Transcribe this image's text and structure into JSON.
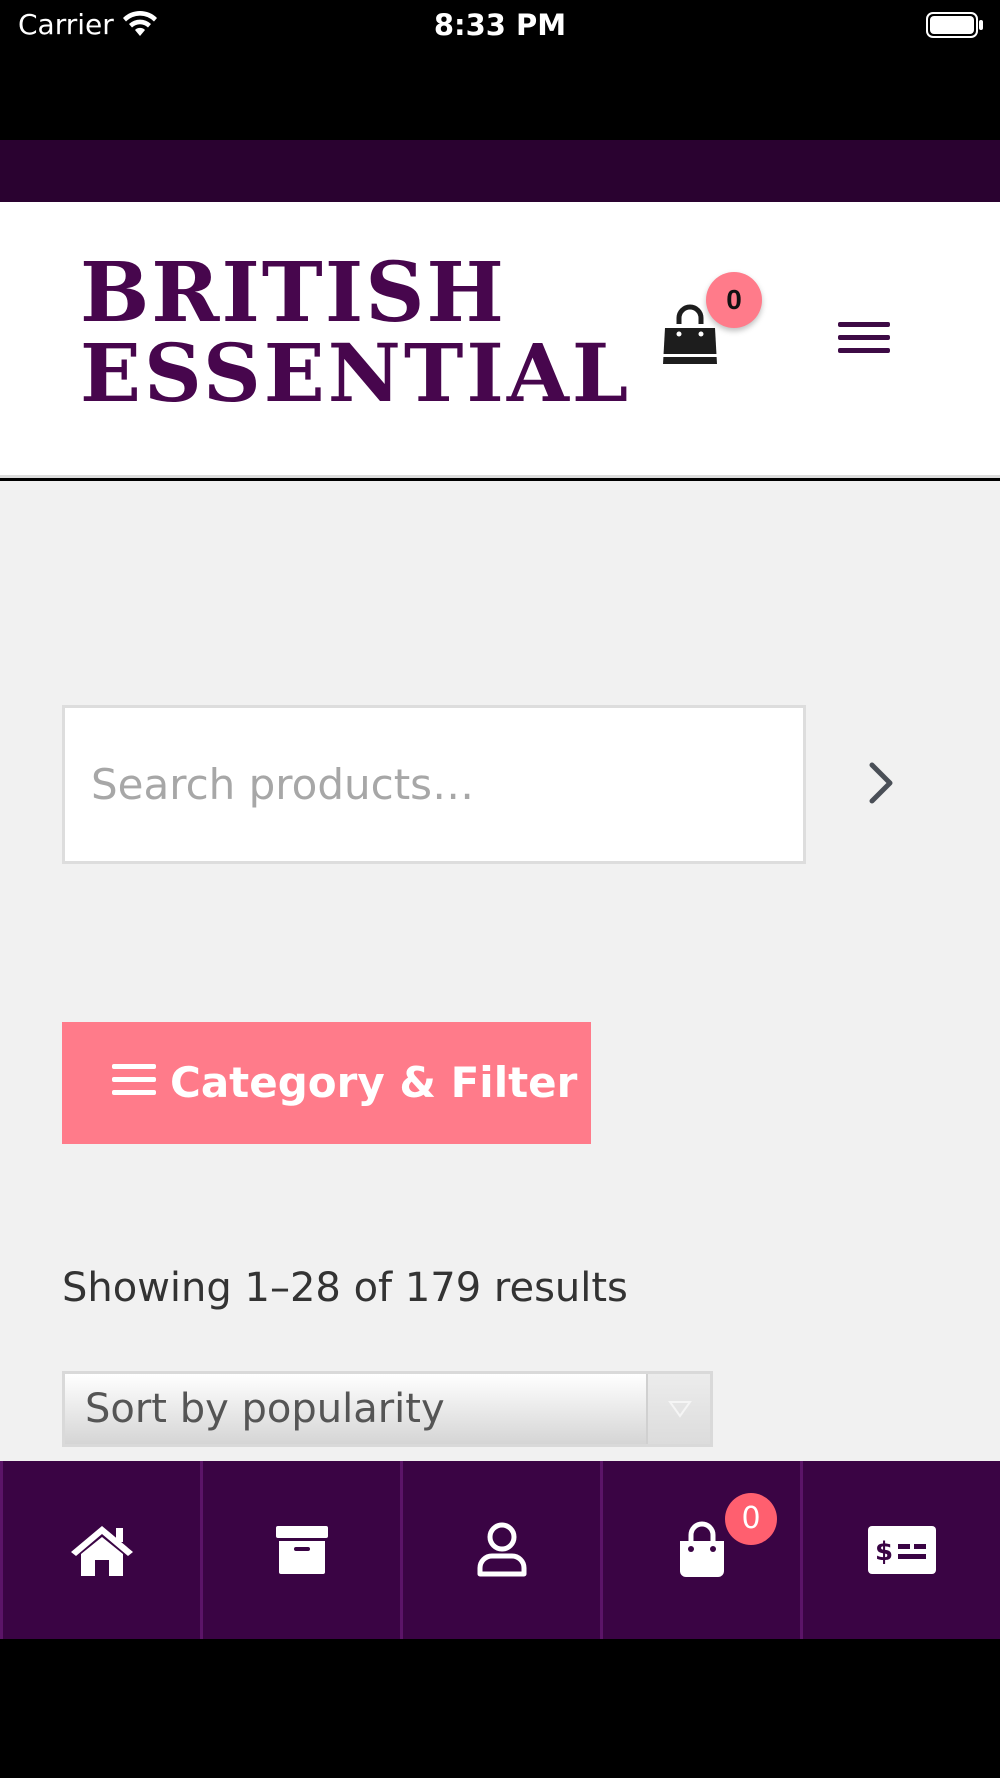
{
  "status_bar": {
    "carrier": "Carrier",
    "time": "8:33 PM"
  },
  "header": {
    "logo_line1": "BRITISH",
    "logo_line2": "ESSENTIAL",
    "cart_count": "0",
    "brand_color": "#47064d",
    "badge_color": "#ff7b8a"
  },
  "search": {
    "placeholder": "Search products…",
    "value": ""
  },
  "filter": {
    "label": "Category & Filter",
    "color": "#ff7b8a"
  },
  "results": {
    "count_text": "Showing 1–28 of 179 results"
  },
  "sort": {
    "selected": "Sort by popularity"
  },
  "tab_bar": {
    "color": "#3a0444",
    "items": [
      {
        "icon": "home-icon"
      },
      {
        "icon": "archive-icon"
      },
      {
        "icon": "user-icon"
      },
      {
        "icon": "shopping-bag-icon",
        "badge": "0"
      },
      {
        "icon": "money-bill-icon"
      }
    ]
  }
}
